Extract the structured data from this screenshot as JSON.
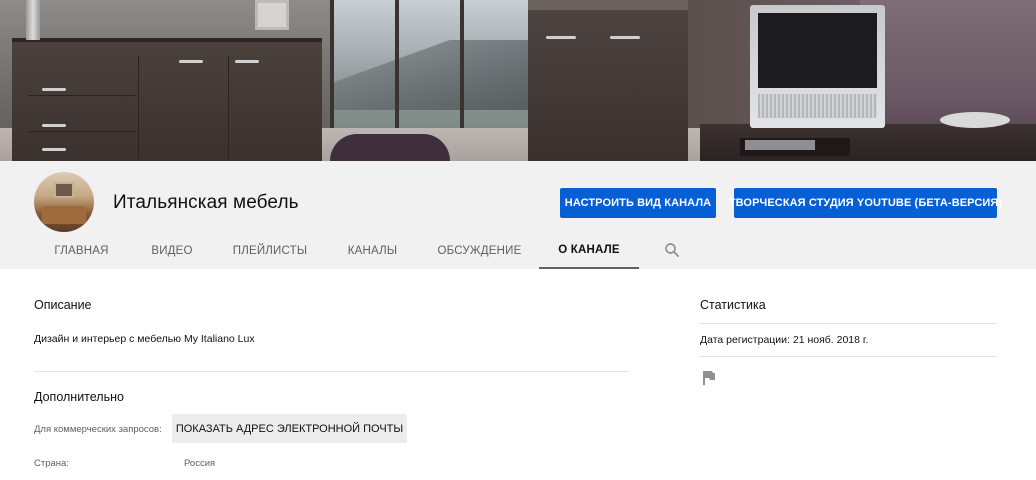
{
  "channel": {
    "title": "Итальянская мебель",
    "customize_button": "НАСТРОИТЬ ВИД КАНАЛА",
    "studio_button": "ТВОРЧЕСКАЯ СТУДИЯ YOUTUBE (БЕТА-ВЕРСИЯ)"
  },
  "tabs": [
    {
      "label": "ГЛАВНАЯ",
      "active": false
    },
    {
      "label": "ВИДЕО",
      "active": false
    },
    {
      "label": "ПЛЕЙЛИСТЫ",
      "active": false
    },
    {
      "label": "КАНАЛЫ",
      "active": false
    },
    {
      "label": "ОБСУЖДЕНИЕ",
      "active": false
    },
    {
      "label": "О КАНАЛЕ",
      "active": true
    }
  ],
  "about": {
    "description_heading": "Описание",
    "description_text": "Дизайн и интерьер с мебелью My Italiano Lux",
    "additional_heading": "Дополнительно",
    "business_label": "Для коммерческих запросов:",
    "show_email_button": "ПОКАЗАТЬ АДРЕС ЭЛЕКТРОННОЙ ПОЧТЫ",
    "country_label": "Страна:",
    "country_value": "Россия"
  },
  "stats": {
    "heading": "Статистика",
    "registration": "Дата регистрации: 21 нояб. 2018 г."
  },
  "icons": {
    "search": "search-icon",
    "flag": "flag-icon"
  },
  "colors": {
    "accent": "#065fd4",
    "header_bg": "#f1f1f1"
  }
}
